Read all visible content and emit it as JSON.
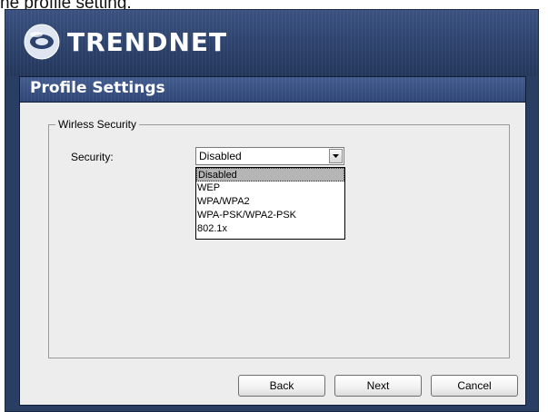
{
  "caption": "he profile setting.",
  "brand": {
    "name": "TRENDNET"
  },
  "window": {
    "title": "Profile Settings"
  },
  "group": {
    "legend": "Wirless Security"
  },
  "security": {
    "label": "Security:",
    "selected": "Disabled",
    "options": [
      "Disabled",
      "WEP",
      "WPA/WPA2",
      "WPA-PSK/WPA2-PSK",
      "802.1x"
    ]
  },
  "buttons": {
    "back": "Back",
    "next": "Next",
    "cancel": "Cancel"
  },
  "colors": {
    "header": "#2c426c",
    "content": "#ededed",
    "highlight": "#b5b5b5"
  }
}
